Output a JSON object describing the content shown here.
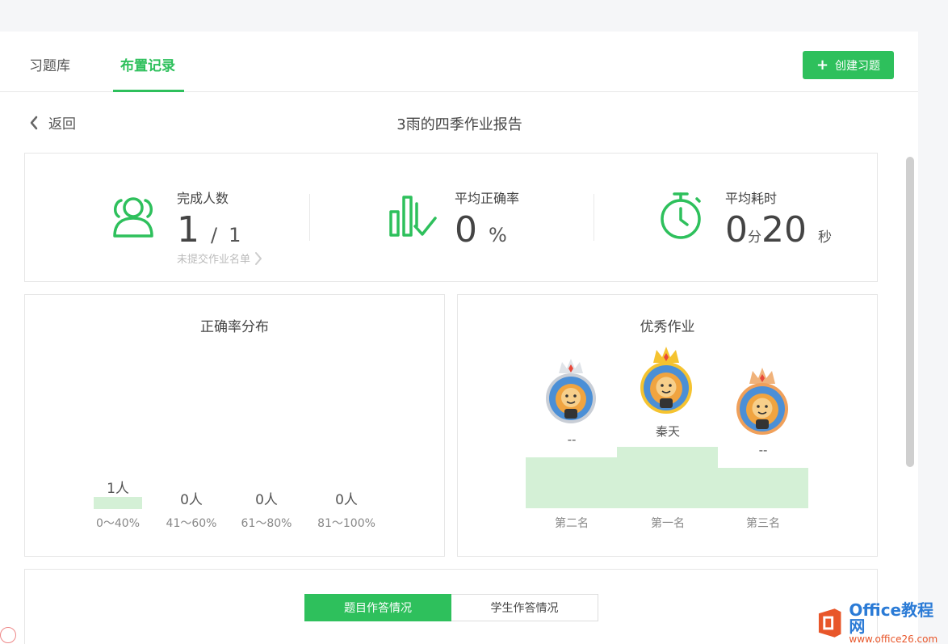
{
  "tabs": [
    {
      "label": "习题库",
      "active": false
    },
    {
      "label": "布置记录",
      "active": true
    }
  ],
  "create_button": {
    "label": "创建习题",
    "icon": "plus-icon"
  },
  "back": {
    "label": "返回",
    "icon": "chevron-left-icon"
  },
  "report_title": "3雨的四季作业报告",
  "stats": {
    "completion": {
      "label": "完成人数",
      "done": "1",
      "separator": "/",
      "total": "1",
      "link": "未提交作业名单",
      "icon": "users-icon"
    },
    "accuracy": {
      "label": "平均正确率",
      "value": "0",
      "unit": "%",
      "icon": "bar-check-icon"
    },
    "time": {
      "label": "平均耗时",
      "minutes": "0",
      "minutes_unit": "分",
      "seconds": "20",
      "seconds_unit": "秒",
      "icon": "stopwatch-icon"
    }
  },
  "distribution": {
    "title": "正确率分布",
    "buckets": [
      {
        "count": "1人",
        "range": "0～40%"
      },
      {
        "count": "0人",
        "range": "41～60%"
      },
      {
        "count": "0人",
        "range": "61～80%"
      },
      {
        "count": "0人",
        "range": "81～100%"
      }
    ]
  },
  "excellent": {
    "title": "优秀作业",
    "places": [
      {
        "rank": "第二名",
        "name": "--"
      },
      {
        "rank": "第一名",
        "name": "秦天"
      },
      {
        "rank": "第三名",
        "name": "--"
      }
    ]
  },
  "bottom_tabs": [
    {
      "label": "题目作答情况",
      "active": true
    },
    {
      "label": "学生作答情况",
      "active": false
    }
  ],
  "watermark": {
    "brand": "Office教程网",
    "url": "www.office26.com"
  },
  "colors": {
    "accent": "#2ec05c",
    "podium": "#d4f0d6",
    "silver": "#c9ced6",
    "gold": "#f5c330",
    "bronze": "#f0a05a"
  }
}
